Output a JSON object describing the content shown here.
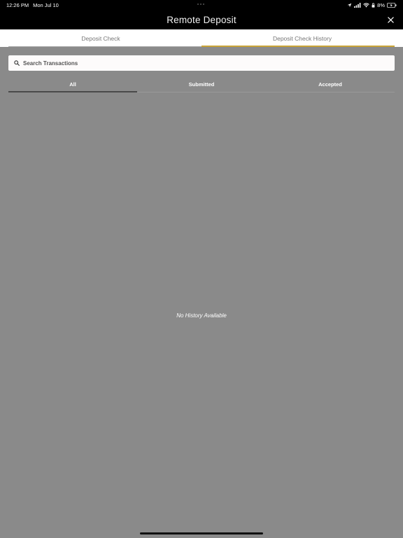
{
  "status_bar": {
    "time": "12:26 PM",
    "date": "Mon Jul 10",
    "battery": "8%",
    "icons": [
      "location-icon",
      "signal-icon",
      "wifi-icon",
      "lock-icon",
      "battery-icon"
    ]
  },
  "header": {
    "title": "Remote Deposit",
    "close_icon": "close-icon"
  },
  "segment_tabs": [
    {
      "label": "Deposit Check",
      "active": false
    },
    {
      "label": "Deposit Check History",
      "active": true
    }
  ],
  "search": {
    "placeholder": "Search Transactions",
    "value": "",
    "icon": "search-icon"
  },
  "filter_tabs": [
    {
      "label": "All",
      "active": true
    },
    {
      "label": "Submitted",
      "active": false
    },
    {
      "label": "Accepted",
      "active": false
    }
  ],
  "empty_state": {
    "message": "No History Available"
  },
  "colors": {
    "accent": "#c9a437",
    "background": "#8a8a8a",
    "header": "#000000"
  }
}
